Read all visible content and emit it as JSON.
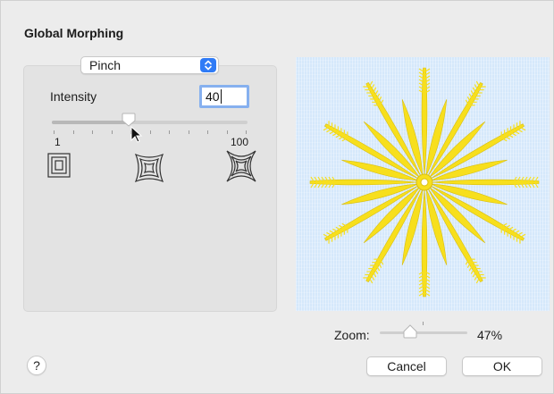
{
  "dialog": {
    "title": "Global Morphing"
  },
  "morph": {
    "type_selected": "Pinch",
    "intensity_label": "Intensity",
    "intensity_value": "40",
    "slider": {
      "min_label": "1",
      "max_label": "100",
      "value": 40,
      "min": 1,
      "max": 100
    },
    "shape_icons": [
      "square-icon",
      "pinch-square-icon",
      "spiky-square-icon"
    ]
  },
  "zoom": {
    "label": "Zoom:",
    "value_text": "47%",
    "value": 47
  },
  "buttons": {
    "help": "?",
    "cancel": "Cancel",
    "ok": "OK"
  },
  "colors": {
    "accent": "#2f7bf6",
    "focus_ring": "#86b0ef",
    "preview_bg": "#d5e8fb",
    "embroidery_yellow": "#f7df1d"
  }
}
